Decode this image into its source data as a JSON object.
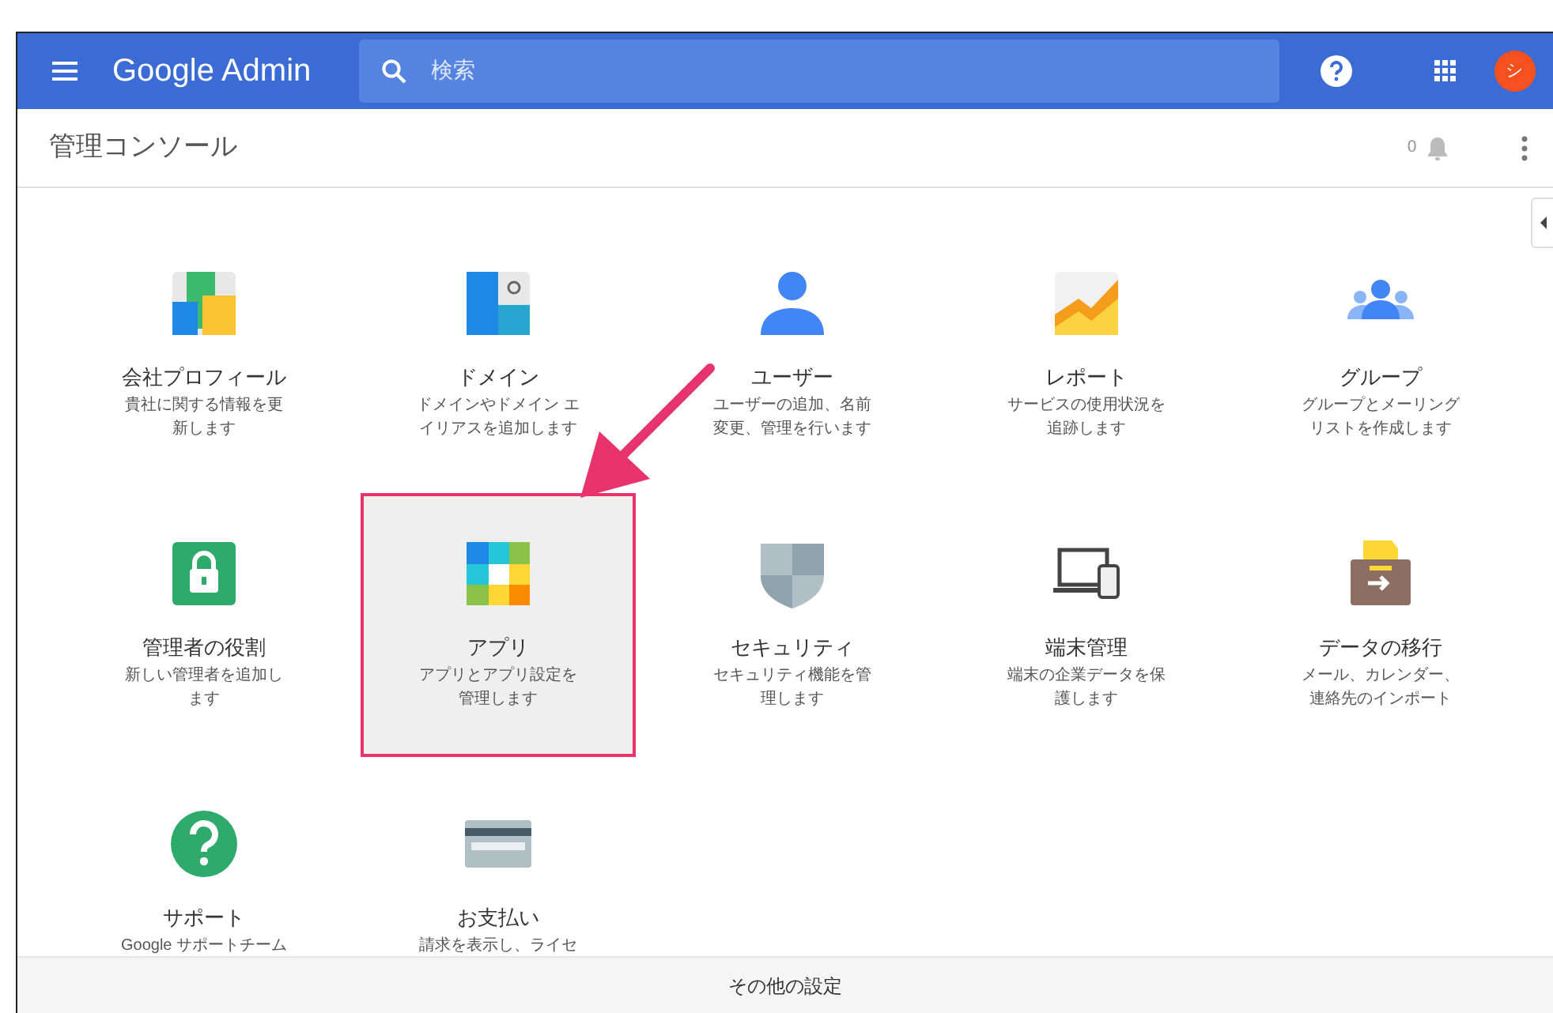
{
  "topbar": {
    "product": "Google Admin",
    "search": {
      "placeholder": "検索"
    },
    "avatar": "シ"
  },
  "header": {
    "title": "管理コンソール",
    "notifications": "0"
  },
  "tiles": [
    {
      "title": "会社プロフィール",
      "description": "貴社に関する情報を更新します",
      "highlighted": false
    },
    {
      "title": "ドメイン",
      "description": "ドメインやドメイン エイリアスを追加します",
      "highlighted": false
    },
    {
      "title": "ユーザー",
      "description": "ユーザーの追加、名前変更、管理を行います",
      "highlighted": false
    },
    {
      "title": "レポート",
      "description": "サービスの使用状況を追跡します",
      "highlighted": false
    },
    {
      "title": "グループ",
      "description": "グループとメーリングリストを作成します",
      "highlighted": false
    },
    {
      "title": "管理者の役割",
      "description": "新しい管理者を追加します",
      "highlighted": false
    },
    {
      "title": "アプリ",
      "description": "アプリとアプリ設定を管理します",
      "highlighted": true
    },
    {
      "title": "セキュリティ",
      "description": "セキュリティ機能を管理します",
      "highlighted": false
    },
    {
      "title": "端末管理",
      "description": "端末の企業データを保護します",
      "highlighted": false
    },
    {
      "title": "データの移行",
      "description": "メール、カレンダー、連絡先のインポート",
      "highlighted": false
    },
    {
      "title": "サポート",
      "description": "Google サポートチーム",
      "highlighted": false
    },
    {
      "title": "お支払い",
      "description": "請求を表示し、ライセ",
      "highlighted": false
    }
  ],
  "footer": {
    "label": "その他の設定"
  }
}
